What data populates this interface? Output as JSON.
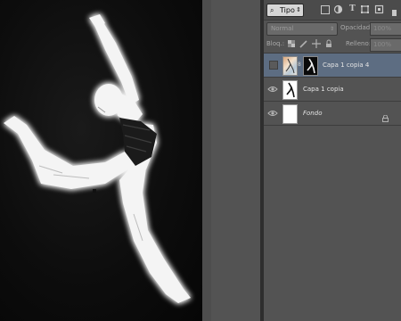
{
  "layers_panel": {
    "filter": {
      "kind_label": "Tipo",
      "search_glyph": "⌕",
      "arrow": "⇕"
    },
    "filter_icons": [
      "image-filter-icon",
      "adjustment-filter-icon",
      "type-filter-icon",
      "shape-filter-icon",
      "smart-object-filter-icon"
    ],
    "type_glyph": "T",
    "blend_mode": "Normal",
    "opacity_label": "Opacidad:",
    "opacity_value": "100%",
    "lock_label": "Bloq.:",
    "fill_label": "Relleno:",
    "fill_value": "100%",
    "layers": [
      {
        "name": "Capa 1 copia 4",
        "visible": false,
        "selected": true,
        "has_mask": true
      },
      {
        "name": "Capa 1 copia",
        "visible": true,
        "selected": false,
        "has_mask": false
      },
      {
        "name": "Fondo",
        "visible": true,
        "selected": false,
        "locked": true
      }
    ],
    "eye_glyph": "👁",
    "chain_glyph": "8"
  },
  "colors": {
    "panel_bg": "#535353",
    "selected_layer": "#5d6d82",
    "canvas_bg": "#0d0d0d"
  }
}
